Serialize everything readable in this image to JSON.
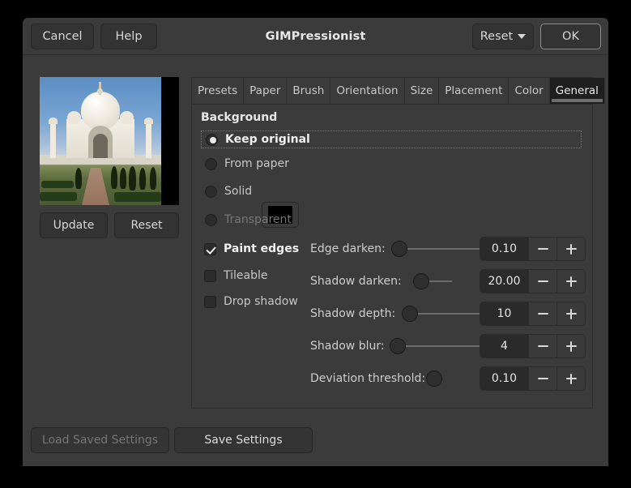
{
  "header": {
    "title": "GIMPressionist",
    "cancel_label": "Cancel",
    "help_label": "Help",
    "reset_label": "Reset",
    "ok_label": "OK"
  },
  "preview": {
    "update_label": "Update",
    "reset_label": "Reset",
    "image_description": "Taj Mahal photograph preview"
  },
  "tabs": [
    {
      "label": "Presets",
      "active": false
    },
    {
      "label": "Paper",
      "active": false
    },
    {
      "label": "Brush",
      "active": false
    },
    {
      "label": "Orientation",
      "active": false
    },
    {
      "label": "Size",
      "active": false
    },
    {
      "label": "Placement",
      "active": false
    },
    {
      "label": "Color",
      "active": false
    },
    {
      "label": "General",
      "active": true
    }
  ],
  "general": {
    "background_legend": "Background",
    "background_options": [
      {
        "label": "Keep original",
        "selected": true,
        "disabled": false
      },
      {
        "label": "From paper",
        "selected": false,
        "disabled": false
      },
      {
        "label": "Solid",
        "selected": false,
        "disabled": false
      },
      {
        "label": "Transparent",
        "selected": false,
        "disabled": true
      }
    ],
    "solid_color": "#000000",
    "checkboxes": [
      {
        "label": "Paint edges",
        "checked": true
      },
      {
        "label": "Tileable",
        "checked": false
      },
      {
        "label": "Drop shadow",
        "checked": false
      }
    ],
    "sliders": [
      {
        "label": "Edge darken:",
        "value": "0.10"
      },
      {
        "label": "Shadow darken:",
        "value": "20.00"
      },
      {
        "label": "Shadow depth:",
        "value": "10"
      },
      {
        "label": "Shadow blur:",
        "value": "4"
      },
      {
        "label": "Deviation threshold:",
        "value": "0.10"
      }
    ]
  },
  "footer": {
    "load_label": "Load Saved Settings",
    "save_label": "Save Settings"
  }
}
